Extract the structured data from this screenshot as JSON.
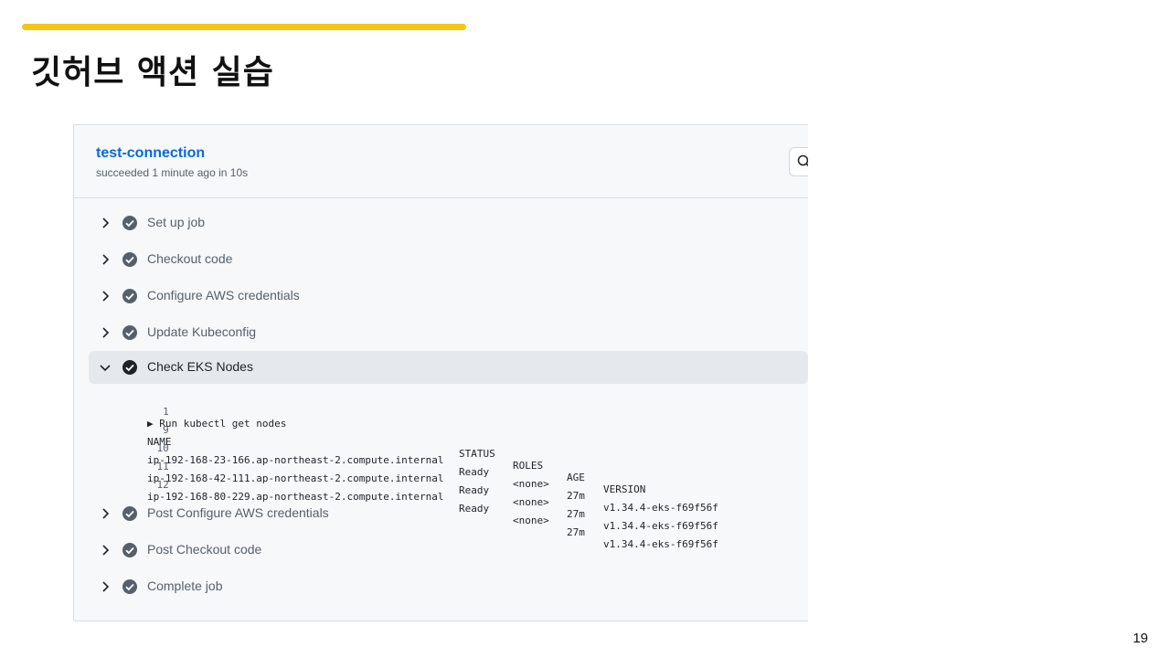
{
  "slide": {
    "title": "깃허브 액션 실습",
    "page_number": "19",
    "accent_color": "#f5c518"
  },
  "job": {
    "title": "test-connection",
    "meta": "succeeded 1 minute ago in 10s",
    "search_icon": "search-icon"
  },
  "steps_before": [
    {
      "label": "Set up job"
    },
    {
      "label": "Checkout code"
    },
    {
      "label": "Configure AWS credentials"
    },
    {
      "label": "Update Kubeconfig"
    }
  ],
  "expanded_step": {
    "label": "Check EKS Nodes"
  },
  "log": {
    "run_line": {
      "num": "1",
      "text": "▶ Run kubectl get nodes"
    },
    "header": {
      "num": "9",
      "name": "NAME",
      "status": "STATUS",
      "roles": "ROLES",
      "age": "AGE",
      "version": "VERSION"
    },
    "rows": [
      {
        "num": "10",
        "name": "ip-192-168-23-166.ap-northeast-2.compute.internal",
        "status": "Ready",
        "roles": "<none>",
        "age": "27m",
        "version": "v1.34.4-eks-f69f56f"
      },
      {
        "num": "11",
        "name": "ip-192-168-42-111.ap-northeast-2.compute.internal",
        "status": "Ready",
        "roles": "<none>",
        "age": "27m",
        "version": "v1.34.4-eks-f69f56f"
      },
      {
        "num": "12",
        "name": "ip-192-168-80-229.ap-northeast-2.compute.internal",
        "status": "Ready",
        "roles": "<none>",
        "age": "27m",
        "version": "v1.34.4-eks-f69f56f"
      }
    ]
  },
  "steps_after": [
    {
      "label": "Post Configure AWS credentials"
    },
    {
      "label": "Post Checkout code"
    },
    {
      "label": "Complete job"
    }
  ]
}
